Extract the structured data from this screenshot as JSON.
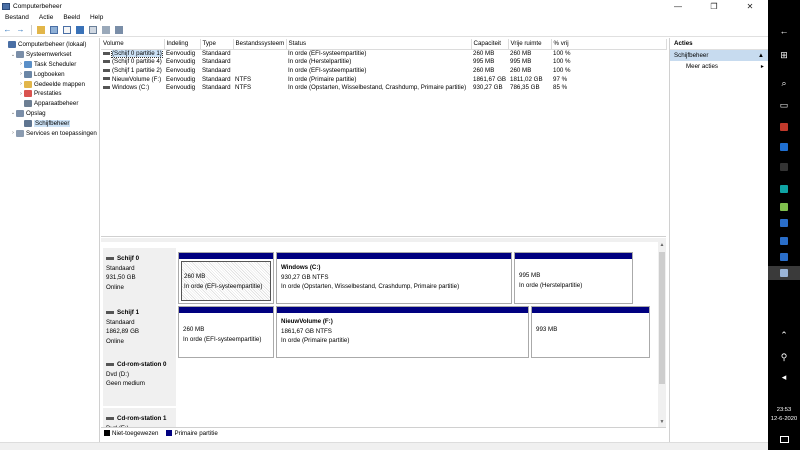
{
  "window": {
    "title": "Computerbeheer",
    "minimize": "—",
    "maximize": "❐",
    "close": "✕"
  },
  "menu": [
    "Bestand",
    "Actie",
    "Beeld",
    "Help"
  ],
  "tree": [
    {
      "label": "Computerbeheer (lokaal)",
      "indent": 0,
      "twisty": "",
      "icon_color": "#4a6fa5"
    },
    {
      "label": "Systeemwerkset",
      "indent": 1,
      "twisty": "⌄",
      "icon_color": "#7a8ea8"
    },
    {
      "label": "Task Scheduler",
      "indent": 2,
      "twisty": "›",
      "icon_color": "#5a8fc8"
    },
    {
      "label": "Logboeken",
      "indent": 2,
      "twisty": "›",
      "icon_color": "#6a86a6"
    },
    {
      "label": "Gedeelde mappen",
      "indent": 2,
      "twisty": "›",
      "icon_color": "#e2b64a"
    },
    {
      "label": "Prestaties",
      "indent": 2,
      "twisty": "›",
      "icon_color": "#d9534f"
    },
    {
      "label": "Apparaatbeheer",
      "indent": 2,
      "twisty": "",
      "icon_color": "#6d7f93"
    },
    {
      "label": "Opslag",
      "indent": 1,
      "twisty": "⌄",
      "icon_color": "#7a8ea8"
    },
    {
      "label": "Schijfbeheer",
      "indent": 2,
      "twisty": "",
      "icon_color": "#5f7590",
      "selected": true
    },
    {
      "label": "Services en toepassingen",
      "indent": 1,
      "twisty": "›",
      "icon_color": "#8a9bb0"
    }
  ],
  "volume_columns": [
    "Volume",
    "Indeling",
    "Type",
    "Bestandssysteem",
    "Status",
    "Capaciteit",
    "Vrije ruimte",
    "% vrij"
  ],
  "volumes": [
    [
      "(Schijf 0 partitie 1)",
      "Eenvoudig",
      "Standaard",
      "",
      "In orde (EFI-systeempartitie)",
      "260 MB",
      "260 MB",
      "100 %"
    ],
    [
      "(Schijf 0 partitie 4)",
      "Eenvoudig",
      "Standaard",
      "",
      "In orde (Herstelpartitie)",
      "995 MB",
      "995 MB",
      "100 %"
    ],
    [
      "(Schijf 1 partitie 2)",
      "Eenvoudig",
      "Standaard",
      "",
      "In orde (EFI-systeempartitie)",
      "260 MB",
      "260 MB",
      "100 %"
    ],
    [
      "NieuwVolume (F:)",
      "Eenvoudig",
      "Standaard",
      "NTFS",
      "In orde (Primaire partitie)",
      "1861,67 GB",
      "1811,02 GB",
      "97 %"
    ],
    [
      "Windows (C:)",
      "Eenvoudig",
      "Standaard",
      "NTFS",
      "In orde (Opstarten, Wisselbestand, Crashdump, Primaire partitie)",
      "930,27 GB",
      "786,35 GB",
      "85 %"
    ]
  ],
  "disks": [
    {
      "name": "Schijf 0",
      "type": "Standaard",
      "size": "931,50 GB",
      "state": "Online",
      "partitions": [
        {
          "name": "",
          "size": "260 MB",
          "status": "In orde (EFI-systeempartitie)",
          "hatched": true
        },
        {
          "name": "Windows  (C:)",
          "size": "930,27 GB NTFS",
          "status": "In orde (Opstarten, Wisselbestand, Crashdump, Primaire partitie)"
        },
        {
          "name": "",
          "size": "995 MB",
          "status": "In orde (Herstelpartitie)"
        }
      ]
    },
    {
      "name": "Schijf 1",
      "type": "Standaard",
      "size": "1862,89 GB",
      "state": "Online",
      "partitions": [
        {
          "name": "",
          "size": "260 MB",
          "status": "In orde (EFI-systeempartitie)"
        },
        {
          "name": "NieuwVolume  (F:)",
          "size": "1861,67 GB NTFS",
          "status": "In orde (Primaire partitie)"
        },
        {
          "name": "",
          "size": "993 MB",
          "status": ""
        }
      ]
    },
    {
      "name": "Cd-rom-station 0",
      "type": "Dvd (D:)",
      "size": "",
      "state": "Geen medium",
      "partitions": []
    },
    {
      "name": "Cd-rom-station 1",
      "type": "Dvd (E:)",
      "size": "",
      "state": "",
      "partitions": []
    }
  ],
  "legend": [
    {
      "label": "Niet-toegewezen",
      "color": "#000000"
    },
    {
      "label": "Primaire partitie",
      "color": "#000080"
    }
  ],
  "actions": {
    "header": "Acties",
    "section": "Schijfbeheer",
    "items": [
      "Meer acties"
    ]
  },
  "taskbar": {
    "time": "23:53",
    "date": "12-6-2020",
    "icons": [
      "back-icon",
      "windows-icon",
      "search-icon",
      "task-view-icon",
      "app-icon",
      "app-icon",
      "app-icon",
      "app-icon",
      "app-icon",
      "app-icon",
      "app-icon",
      "app-icon",
      "app-icon",
      "app-icon",
      "computer-management-icon"
    ]
  }
}
